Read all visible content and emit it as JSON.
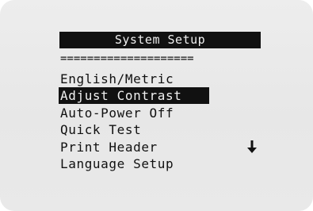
{
  "screen": {
    "title": "System Setup",
    "divider": "===================="
  },
  "menu": {
    "items": [
      {
        "label": "English/Metric"
      },
      {
        "label": "Adjust Contrast"
      },
      {
        "label": "Auto-Power Off"
      },
      {
        "label": "Quick Test"
      },
      {
        "label": "Print Header"
      },
      {
        "label": "Language Setup"
      }
    ],
    "selected_index": 1,
    "scroll_icon": "down-arrow-icon",
    "scroll_glyph": "🡣"
  },
  "colors": {
    "background": "#e8e8e8",
    "foreground": "#111111",
    "highlight": "#111111",
    "highlight_text": "#f0f0f0"
  }
}
